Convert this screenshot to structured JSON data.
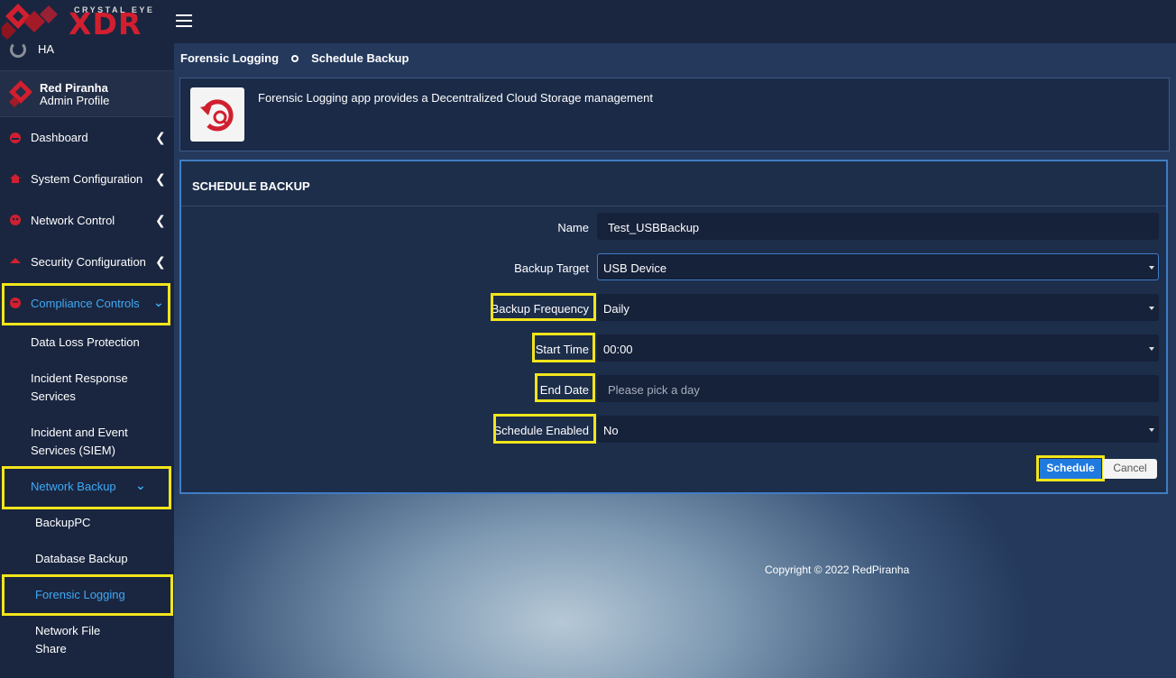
{
  "brand": {
    "small_text": "CRYSTAL EYE",
    "big_text": "XDR"
  },
  "ha_label": "HA",
  "profile": {
    "name": "Red Piranha",
    "role": "Admin Profile"
  },
  "nav": [
    {
      "label": "Dashboard",
      "icon": "dashboard-icon"
    },
    {
      "label": "System Configuration",
      "icon": "home-icon"
    },
    {
      "label": "Network Control",
      "icon": "network-icon"
    },
    {
      "label": "Security Configuration",
      "icon": "shield-icon"
    },
    {
      "label": "Compliance Controls",
      "icon": "compliance-icon"
    }
  ],
  "compliance_sub": [
    "Data Loss Protection",
    "Incident Response Services",
    "Incident and Event Services (SIEM)",
    "Network Backup"
  ],
  "network_backup_sub": [
    "BackupPC",
    "Database Backup",
    "Forensic Logging",
    "Network File Share"
  ],
  "breadcrumb": [
    "Forensic Logging",
    "Schedule Backup"
  ],
  "app_description": "Forensic Logging app provides a Decentralized Cloud Storage management",
  "panel_title": "SCHEDULE BACKUP",
  "form": {
    "name": {
      "label": "Name",
      "value": "Test_USBBackup"
    },
    "backup_target": {
      "label": "Backup Target",
      "value": "USB Device"
    },
    "backup_frequency": {
      "label": "Backup Frequency",
      "value": "Daily"
    },
    "start_time": {
      "label": "Start Time",
      "value": "00:00"
    },
    "end_date": {
      "label": "End Date",
      "placeholder": "Please pick a day"
    },
    "schedule_enabled": {
      "label": "Schedule Enabled",
      "value": "No"
    }
  },
  "buttons": {
    "schedule": "Schedule",
    "cancel": "Cancel"
  },
  "copyright": "Copyright © 2022 RedPiranha",
  "colors": {
    "accent": "#3fa9f5",
    "highlight": "#f2e51b",
    "brand_red": "#d11f2f",
    "primary_button": "#1f7ae0"
  }
}
